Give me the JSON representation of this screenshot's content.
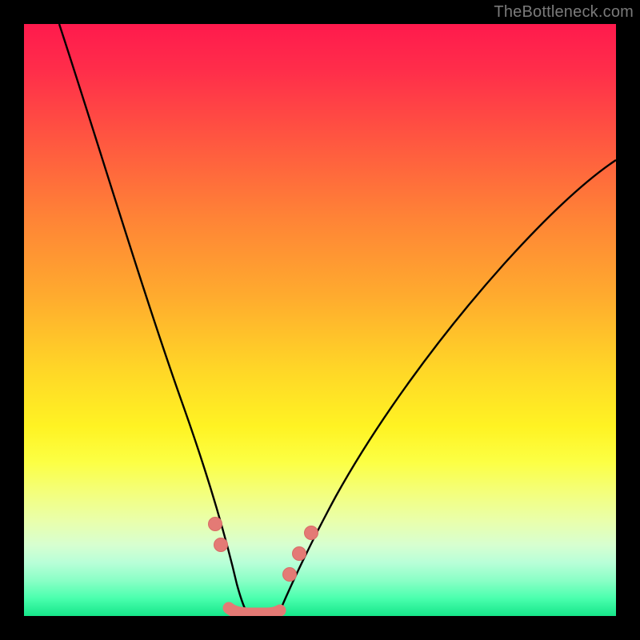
{
  "watermark": "TheBottleneck.com",
  "colors": {
    "frame": "#000000",
    "curve_stroke": "#000000",
    "marker_fill": "#e47a75",
    "marker_stroke": "#d86b66"
  },
  "chart_data": {
    "type": "line",
    "title": "",
    "xlabel": "",
    "ylabel": "",
    "xlim": [
      0,
      100
    ],
    "ylim": [
      0,
      100
    ],
    "grid": false,
    "legend": false,
    "note": "No numeric axis ticks or labels are visible; curve data is estimated from pixel positions on a 0-100 normalized scale where y=0 is the bottom (green) and y=100 is the top (red).",
    "series": [
      {
        "name": "left-curve",
        "x": [
          6,
          10,
          14,
          18,
          22,
          25,
          28,
          30,
          32,
          34,
          36,
          37.5
        ],
        "y": [
          100,
          85,
          71,
          58,
          46,
          37,
          28,
          22,
          16,
          10,
          5,
          1
        ]
      },
      {
        "name": "right-curve",
        "x": [
          43,
          46,
          50,
          55,
          60,
          66,
          73,
          81,
          90,
          100
        ],
        "y": [
          1,
          5,
          12,
          20,
          29,
          38,
          48,
          58,
          67,
          76
        ]
      },
      {
        "name": "markers",
        "type": "scatter",
        "points": [
          {
            "x": 32.2,
            "y": 15.5
          },
          {
            "x": 33.2,
            "y": 12.0
          },
          {
            "x": 44.8,
            "y": 7.0
          },
          {
            "x": 46.5,
            "y": 10.5
          },
          {
            "x": 48.5,
            "y": 14.0
          }
        ]
      },
      {
        "name": "floor-band",
        "type": "line",
        "note": "Thick marker-colored segment along the bottom between the two curves",
        "x": [
          34.5,
          43.0
        ],
        "y": [
          1.0,
          1.0
        ]
      }
    ]
  }
}
